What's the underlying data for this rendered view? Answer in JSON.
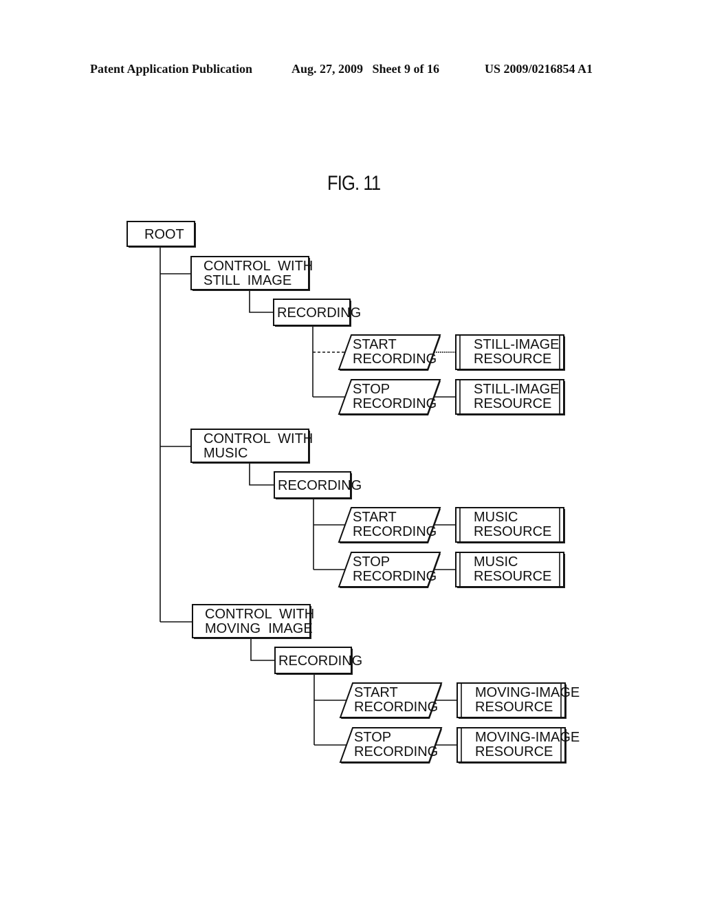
{
  "header": {
    "publication_type": "Patent Application Publication",
    "date_sheet": "Aug. 27, 2009   Sheet 9 of 16",
    "patent_number": "US 2009/0216854 A1"
  },
  "figure": {
    "title": "FIG. 11",
    "root": {
      "label": "ROOT"
    },
    "branches": [
      {
        "control": [
          "CONTROL  WITH",
          "STILL  IMAGE"
        ],
        "recording": "RECORDING",
        "operations": [
          {
            "action": [
              "START",
              "RECORDING"
            ],
            "resource": [
              "STILL-IMAGE",
              "RESOURCE"
            ]
          },
          {
            "action": [
              "STOP",
              "RECORDING"
            ],
            "resource": [
              "STILL-IMAGE",
              "RESOURCE"
            ]
          }
        ]
      },
      {
        "control": [
          "CONTROL  WITH",
          "MUSIC"
        ],
        "recording": "RECORDING",
        "operations": [
          {
            "action": [
              "START",
              "RECORDING"
            ],
            "resource": [
              "MUSIC",
              "RESOURCE"
            ]
          },
          {
            "action": [
              "STOP",
              "RECORDING"
            ],
            "resource": [
              "MUSIC",
              "RESOURCE"
            ]
          }
        ]
      },
      {
        "control": [
          "CONTROL  WITH",
          "MOVING  IMAGE"
        ],
        "recording": "RECORDING",
        "operations": [
          {
            "action": [
              "START",
              "RECORDING"
            ],
            "resource": [
              "MOVING-IMAGE",
              "RESOURCE"
            ]
          },
          {
            "action": [
              "STOP",
              "RECORDING"
            ],
            "resource": [
              "MOVING-IMAGE",
              "RESOURCE"
            ]
          }
        ]
      }
    ]
  }
}
